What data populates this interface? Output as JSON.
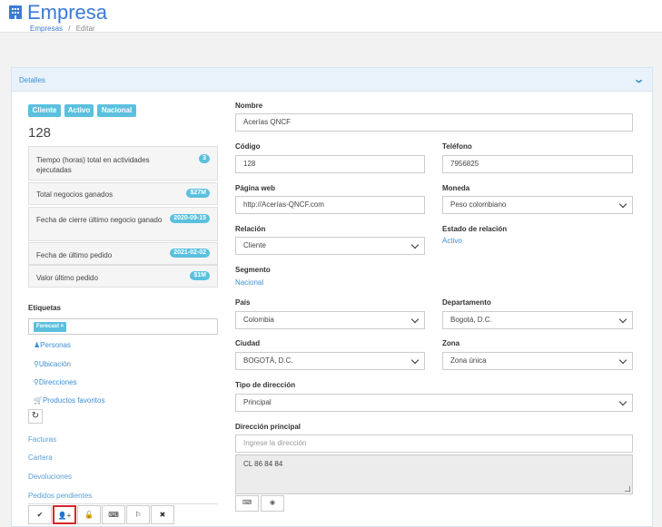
{
  "header": {
    "title": "Empresa",
    "breadcrumb": {
      "root": "Empresas",
      "separator": "/",
      "current": "Editar"
    }
  },
  "panel": {
    "title": "Detalles"
  },
  "badges": [
    "Cliente",
    "Activo",
    "Nacional"
  ],
  "company_number": "128",
  "stats": [
    {
      "label": "Tiempo (horas) total en actividades ejecutadas",
      "value": "3"
    },
    {
      "label": "Total negocios ganados",
      "value": "$27M"
    },
    {
      "label": "Fecha de cierre último negocio ganado",
      "value": "2020-09-15"
    },
    {
      "label": "Fecha de último pedido",
      "value": "2021-02-02"
    },
    {
      "label": "Valor último pedido",
      "value": "$1M"
    }
  ],
  "tags": {
    "label": "Etiquetas",
    "items": [
      "Forecast ×"
    ]
  },
  "links": [
    "Personas",
    "Ubicación",
    "Direcciones",
    "Productos favoritos"
  ],
  "sub_links": [
    "Facturas",
    "Cartera",
    "Devoluciones",
    "Pedidos pendientes"
  ],
  "form": {
    "nombre": {
      "label": "Nombre",
      "value": "Acerías QNCF"
    },
    "codigo": {
      "label": "Código",
      "value": "128"
    },
    "telefono": {
      "label": "Teléfono",
      "value": "7956825"
    },
    "pagina_web": {
      "label": "Página web",
      "value": "http://Acerías-QNCF.com"
    },
    "moneda": {
      "label": "Moneda",
      "value": "Peso colombiano"
    },
    "relacion": {
      "label": "Relación",
      "value": "Cliente"
    },
    "estado_relacion": {
      "label": "Estado de relación",
      "value": "Activo"
    },
    "segmento": {
      "label": "Segmento",
      "value": "Nacional"
    },
    "pais": {
      "label": "País",
      "value": "Colombia"
    },
    "departamento": {
      "label": "Departamento",
      "value": "Bogotá, D.C."
    },
    "ciudad": {
      "label": "Ciudad",
      "value": "BOGOTÁ, D.C."
    },
    "zona": {
      "label": "Zona",
      "value": "Zona única"
    },
    "tipo_direccion": {
      "label": "Tipo de dirección",
      "value": "Principal"
    },
    "direccion_principal": {
      "label": "Dirección principal",
      "placeholder": "Ingrese la dirección",
      "value": "CL  86 84 84"
    }
  },
  "colors": {
    "accent": "#3b7ad6",
    "badge": "#5bc0de",
    "highlight": "#d9262b"
  }
}
